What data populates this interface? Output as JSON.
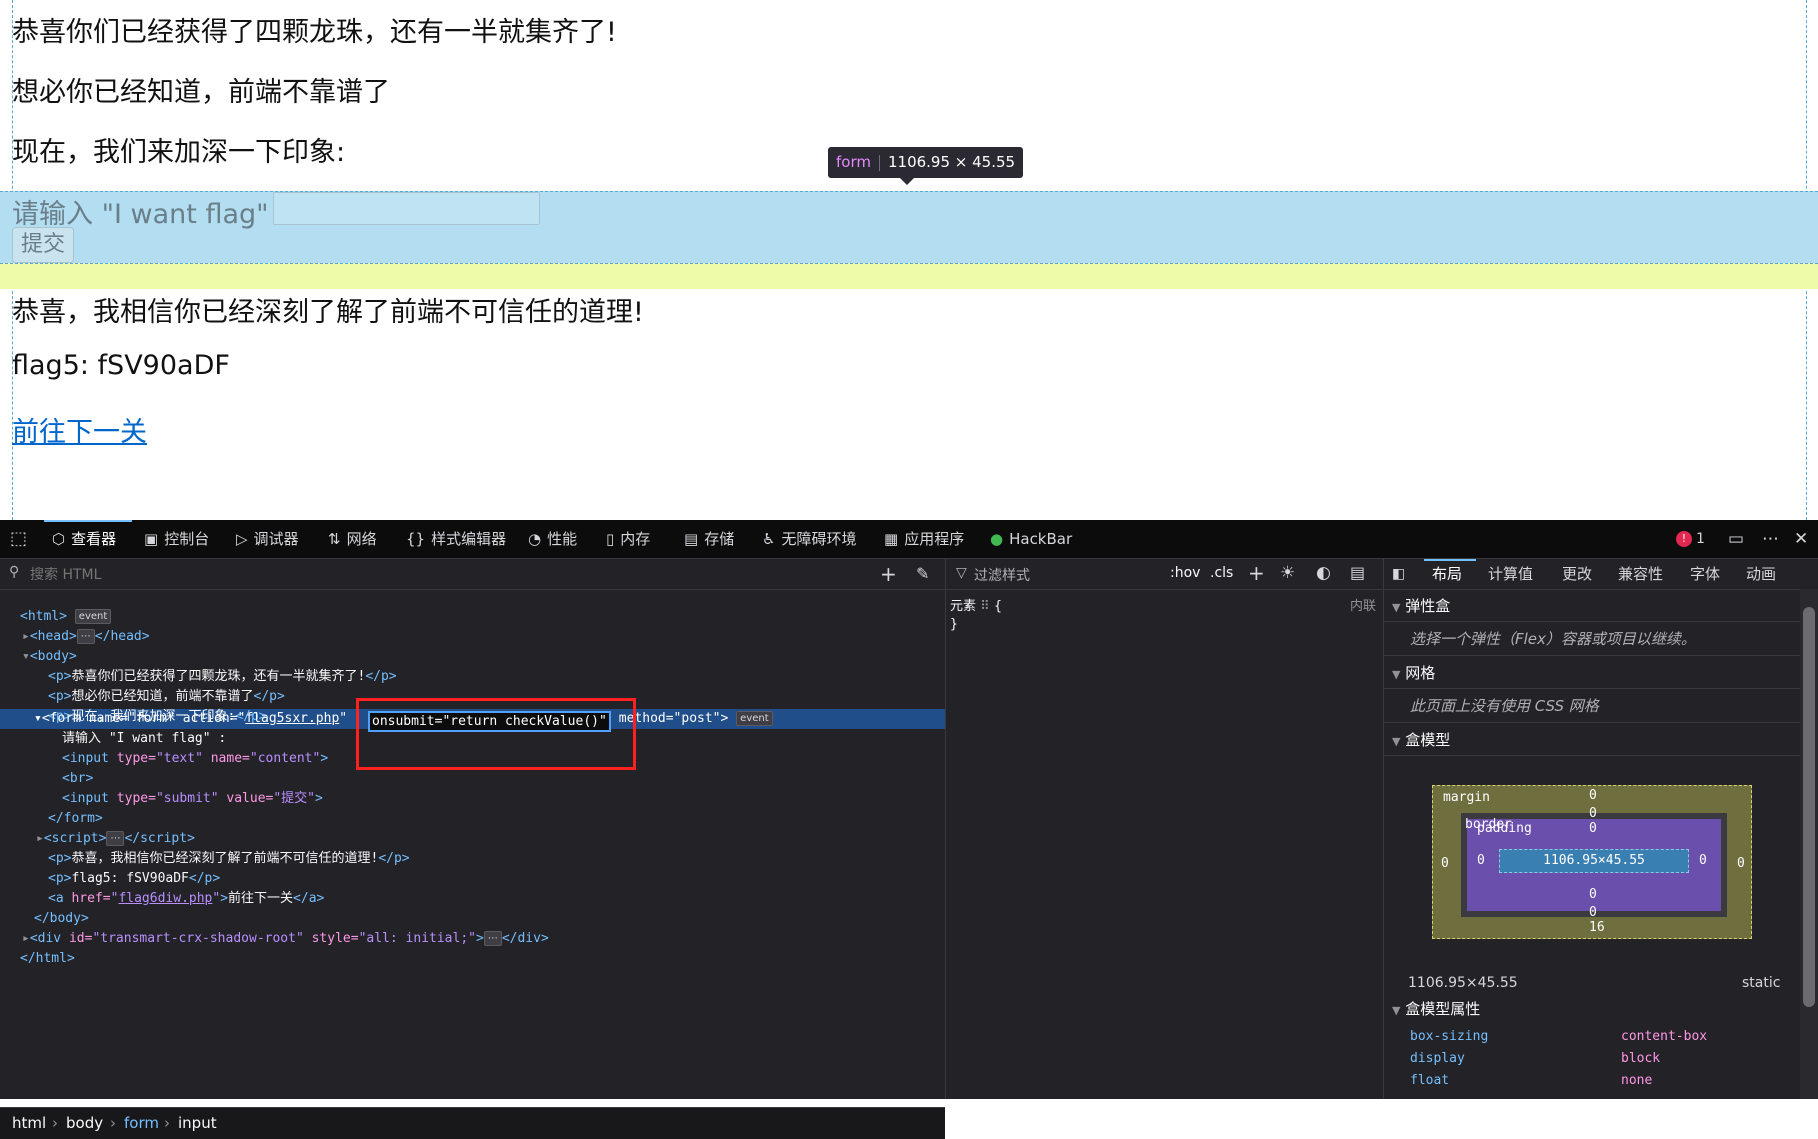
{
  "page": {
    "line1": "恭喜你们已经获得了四颗龙珠，还有一半就集齐了!",
    "line2": "想必你已经知道，前端不靠谱了",
    "line3": "现在，我们来加深一下印象:",
    "form_label": "请输入 \"I want flag\" :",
    "submit_label": "提交",
    "line4": "恭喜，我相信你已经深刻了解了前端不可信任的道理!",
    "flag_line": "flag5: fSV90aDF",
    "next_link": "前往下一关",
    "tooltip_tag": "form",
    "tooltip_size": "1106.95 × 45.55"
  },
  "toolbar": {
    "tabs": [
      "查看器",
      "控制台",
      "调试器",
      "网络",
      "样式编辑器",
      "性能",
      "内存",
      "存储",
      "无障碍环境",
      "应用程序",
      "HackBar"
    ],
    "error_count": "1"
  },
  "markup": {
    "search_placeholder": "搜索 HTML",
    "event_badge": "event",
    "lines": {
      "html_open": "<html>",
      "head": "<head>",
      "head_close": "</head>",
      "body_open": "<body>",
      "p1": "恭喜你们已经获得了四颗龙珠，还有一半就集齐了!",
      "p2": "想必你已经知道，前端不靠谱了",
      "p3": "现在，我们来加深一下印象:",
      "form_text": "请输入 \"I want flag\" :",
      "p4": "恭喜，我相信你已经深刻了解了前端不可信任的道理!",
      "p5": "flag5: fSV90aDF",
      "a_text": "前往下一关"
    }
  },
  "breadcrumb": [
    "html",
    "body",
    "form",
    "input"
  ],
  "rules": {
    "filter_placeholder": "过滤样式",
    "hov": ":hov",
    "cls": ".cls",
    "element_rule": "元素",
    "inline": "内联"
  },
  "layout": {
    "tabs": [
      "布局",
      "计算值",
      "更改",
      "兼容性",
      "字体",
      "动画"
    ],
    "flex_title": "弹性盒",
    "flex_body": "选择一个弹性（Flex）容器或项目以继续。",
    "grid_title": "网格",
    "grid_body": "此页面上没有使用 CSS 网格",
    "boxmodel_title": "盒模型",
    "bm_margin": "margin",
    "bm_border": "border",
    "bm_padding": "padding",
    "bm_content": "1106.95×45.55",
    "bm_margin_bottom": "16",
    "bm_zero": "0",
    "dims": "1106.95×45.55",
    "position": "static",
    "props_title": "盒模型属性",
    "props": [
      {
        "name": "box-sizing",
        "value": "content-box"
      },
      {
        "name": "display",
        "value": "block"
      },
      {
        "name": "float",
        "value": "none"
      }
    ]
  },
  "colors": {
    "form_highlight": "#b3def1",
    "margin_highlight": "#eefba9",
    "link": "#0066cc",
    "devtools_bg": "#232327",
    "selected_row": "#204e8a",
    "annotation_box": "#ff2020"
  }
}
